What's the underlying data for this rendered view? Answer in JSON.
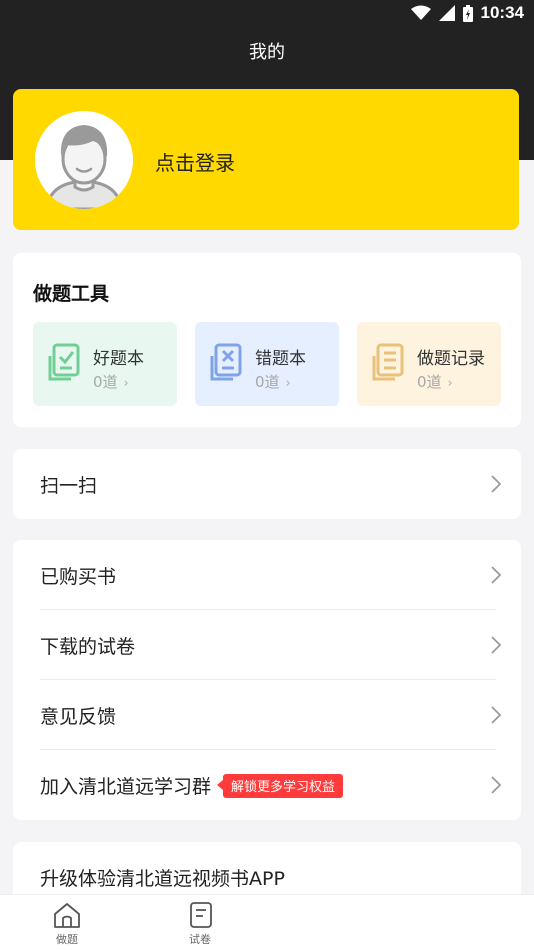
{
  "status_bar": {
    "time": "10:34"
  },
  "header": {
    "title": "我的"
  },
  "login": {
    "label": "点击登录"
  },
  "tools": {
    "title": "做题工具",
    "items": [
      {
        "label": "好题本",
        "count": "0道",
        "icon": "check-doc-icon",
        "color": "#6fcf97",
        "bg": "#e8f8f0"
      },
      {
        "label": "错题本",
        "count": "0道",
        "icon": "x-doc-icon",
        "color": "#7ea3e6",
        "bg": "#e6efff"
      },
      {
        "label": "做题记录",
        "count": "0道",
        "icon": "record-doc-icon",
        "color": "#e8c27a",
        "bg": "#fdf3de"
      }
    ],
    "chevron": "›"
  },
  "scan": {
    "label": "扫一扫"
  },
  "menu": {
    "items": [
      {
        "label": "已购买书"
      },
      {
        "label": "下载的试卷"
      },
      {
        "label": "意见反馈"
      },
      {
        "label": "加入清北道远学习群",
        "badge": "解锁更多学习权益"
      }
    ]
  },
  "upgrade": {
    "label": "升级体验清北道远视频书APP"
  },
  "tabbar": {
    "items": [
      {
        "label": "做题",
        "icon": "home-icon"
      },
      {
        "label": "试卷",
        "icon": "paper-icon"
      }
    ]
  },
  "colors": {
    "header_bg": "#222222",
    "accent": "#ffd900",
    "badge": "#ff3b3b"
  }
}
